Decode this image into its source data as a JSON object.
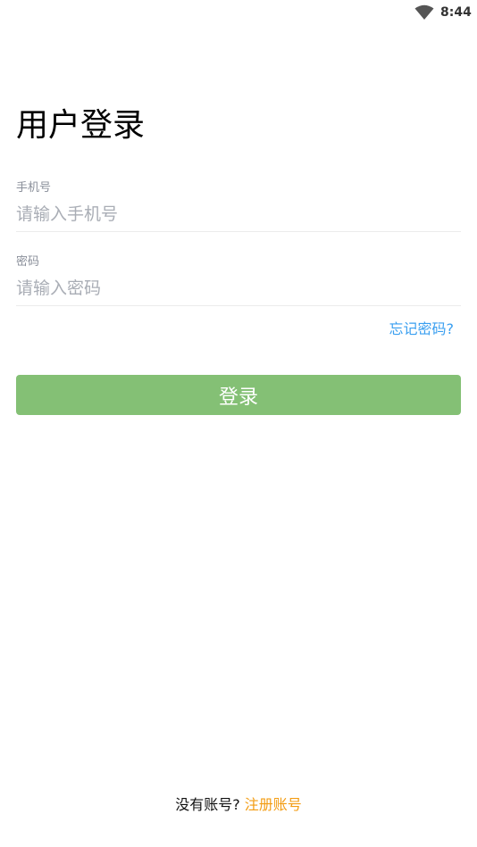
{
  "status_bar": {
    "time": "8:44",
    "wifi_icon": "wifi-icon"
  },
  "page": {
    "title": "用户登录"
  },
  "form": {
    "phone": {
      "label": "手机号",
      "placeholder": "请输入手机号",
      "value": ""
    },
    "password": {
      "label": "密码",
      "placeholder": "请输入密码",
      "value": ""
    },
    "forgot_link": "忘记密码?",
    "login_button": "登录"
  },
  "footer": {
    "prompt": "没有账号?",
    "register_link": "注册账号"
  },
  "colors": {
    "primary_button": "#84c075",
    "link_blue": "#3a9ff0",
    "link_orange": "#f39c12"
  }
}
